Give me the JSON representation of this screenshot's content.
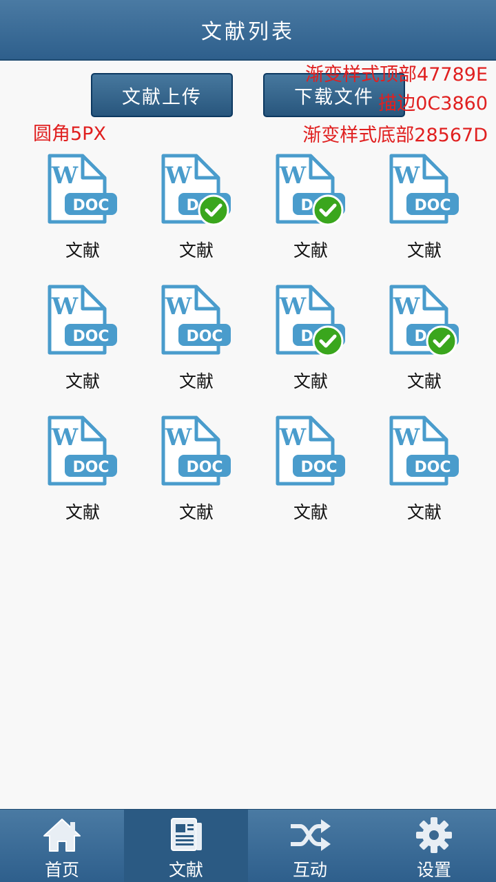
{
  "header": {
    "title": "文献列表"
  },
  "toolbar": {
    "upload_label": "文献上传",
    "download_label": "下载文件"
  },
  "annotations": {
    "gradient_top": "渐变样式顶部47789E",
    "border": "描边0C3860",
    "gradient_bottom": "渐变样式底部28567D",
    "radius": "圆角5PX"
  },
  "colors": {
    "gradient_top": "#47789E",
    "gradient_bottom": "#28567D",
    "border": "#0C3860",
    "doc_icon": "#4a9ccc",
    "check": "#3aa61d"
  },
  "documents": [
    {
      "label": "文献",
      "checked": false
    },
    {
      "label": "文献",
      "checked": true
    },
    {
      "label": "文献",
      "checked": true
    },
    {
      "label": "文献",
      "checked": false
    },
    {
      "label": "文献",
      "checked": false
    },
    {
      "label": "文献",
      "checked": false
    },
    {
      "label": "文献",
      "checked": true
    },
    {
      "label": "文献",
      "checked": true
    },
    {
      "label": "文献",
      "checked": false
    },
    {
      "label": "文献",
      "checked": false
    },
    {
      "label": "文献",
      "checked": false
    },
    {
      "label": "文献",
      "checked": false
    }
  ],
  "doc_icon": {
    "letter": "W",
    "badge": "DOC"
  },
  "tabs": [
    {
      "label": "首页",
      "icon": "home-icon",
      "active": false
    },
    {
      "label": "文献",
      "icon": "document-icon",
      "active": true
    },
    {
      "label": "互动",
      "icon": "shuffle-icon",
      "active": false
    },
    {
      "label": "设置",
      "icon": "gear-icon",
      "active": false
    }
  ]
}
